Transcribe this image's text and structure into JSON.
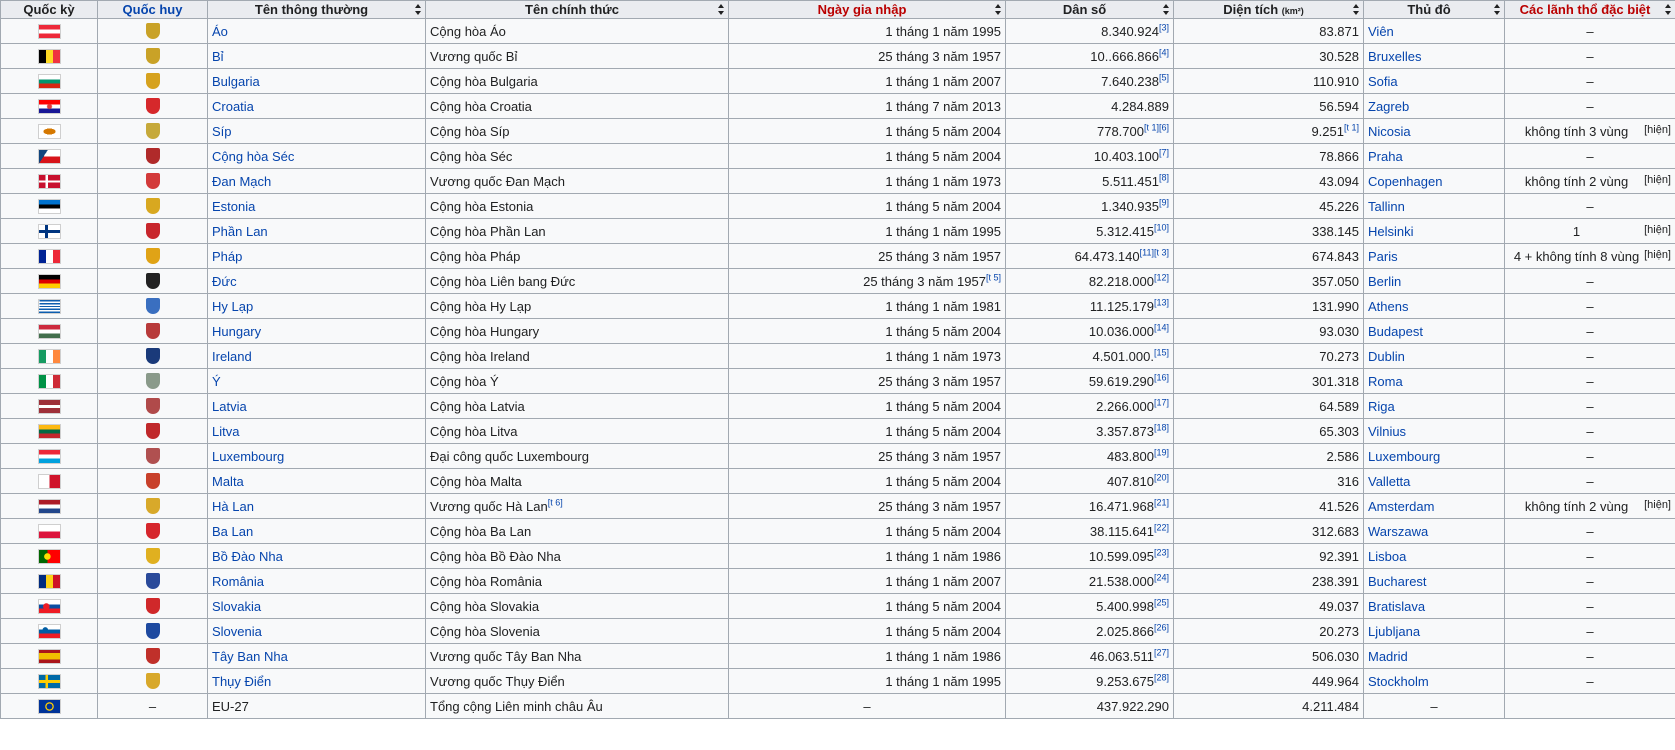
{
  "headers": {
    "flag": "Quốc kỳ",
    "coat": "Quốc huy",
    "common": "Tên thông thường",
    "official": "Tên chính thức",
    "joined": "Ngày gia nhập",
    "population": "Dân số",
    "area": "Diện tích",
    "area_unit": "(km²)",
    "capital": "Thủ đô",
    "special": "Các lãnh thổ đặc biệt"
  },
  "rows": [
    {
      "key": "austria",
      "flag": "austria",
      "coat": "#c9a227",
      "common": "Áo",
      "official": "Cộng hòa Áo",
      "official_sup": "",
      "joined": "1 tháng 1 năm 1995",
      "joined_sup": "",
      "pop": "8.340.924",
      "pop_sup": "[3]",
      "area": "83.871",
      "area_sup": "",
      "capital": "Viên",
      "special": "–",
      "special_sup": ""
    },
    {
      "key": "belgium",
      "flag": "belgium",
      "coat": "#c9a227",
      "common": "Bỉ",
      "official": "Vương quốc Bỉ",
      "official_sup": "",
      "joined": "25 tháng 3 năm 1957",
      "joined_sup": "",
      "pop": "10..666.866",
      "pop_sup": "[4]",
      "area": "30.528",
      "area_sup": "",
      "capital": "Bruxelles",
      "special": "–",
      "special_sup": ""
    },
    {
      "key": "bulgaria",
      "flag": "bulgaria",
      "coat": "#d6a21e",
      "common": "Bulgaria",
      "official": "Cộng hòa Bulgaria",
      "official_sup": "",
      "joined": "1 tháng 1 năm 2007",
      "joined_sup": "",
      "pop": "7.640.238",
      "pop_sup": "[5]",
      "area": "110.910",
      "area_sup": "",
      "capital": "Sofia",
      "special": "–",
      "special_sup": ""
    },
    {
      "key": "croatia",
      "flag": "croatia",
      "coat": "#d6282b",
      "common": "Croatia",
      "official": "Cộng hòa Croatia",
      "official_sup": "",
      "joined": "1 tháng 7 năm 2013",
      "joined_sup": "",
      "pop": "4.284.889",
      "pop_sup": "",
      "area": "56.594",
      "area_sup": "",
      "capital": "Zagreb",
      "special": "–",
      "special_sup": ""
    },
    {
      "key": "cyprus",
      "flag": "cyprus",
      "coat": "#c6a93a",
      "common": "Síp",
      "official": "Cộng hòa Síp",
      "official_sup": "",
      "joined": "1 tháng 5 năm 2004",
      "joined_sup": "",
      "pop": "778.700",
      "pop_sup": "[t 1][6]",
      "area": "9.251",
      "area_sup": "[t 1]",
      "capital": "Nicosia",
      "special": "không tính 3 vùng",
      "special_sup": "[hiện]"
    },
    {
      "key": "czech",
      "flag": "czech",
      "coat": "#b02a2a",
      "common": "Cộng hòa Séc",
      "official": "Cộng hòa Séc",
      "official_sup": "",
      "joined": "1 tháng 5 năm 2004",
      "joined_sup": "",
      "pop": "10.403.100",
      "pop_sup": "[7]",
      "area": "78.866",
      "area_sup": "",
      "capital": "Praha",
      "special": "–",
      "special_sup": ""
    },
    {
      "key": "denmark",
      "flag": "denmark",
      "coat": "#d33a3a",
      "common": "Đan Mạch",
      "official": "Vương quốc Đan Mạch",
      "official_sup": "",
      "joined": "1 tháng 1 năm 1973",
      "joined_sup": "",
      "pop": "5.511.451",
      "pop_sup": "[8]",
      "area": "43.094",
      "area_sup": "",
      "capital": "Copenhagen",
      "special": "không tính 2 vùng",
      "special_sup": "[hiện]"
    },
    {
      "key": "estonia",
      "flag": "estonia",
      "coat": "#d8a820",
      "common": "Estonia",
      "official": "Cộng hòa Estonia",
      "official_sup": "",
      "joined": "1 tháng 5 năm 2004",
      "joined_sup": "",
      "pop": "1.340.935",
      "pop_sup": "[9]",
      "area": "45.226",
      "area_sup": "",
      "capital": "Tallinn",
      "special": "–",
      "special_sup": ""
    },
    {
      "key": "finland",
      "flag": "finland",
      "coat": "#c8262c",
      "common": "Phần Lan",
      "official": "Cộng hòa Phần Lan",
      "official_sup": "",
      "joined": "1 tháng 1 năm 1995",
      "joined_sup": "",
      "pop": "5.312.415",
      "pop_sup": "[10]",
      "area": "338.145",
      "area_sup": "",
      "capital": "Helsinki",
      "special": "1",
      "special_sup": "[hiện]"
    },
    {
      "key": "france",
      "flag": "france",
      "coat": "#e0a316",
      "common": "Pháp",
      "official": "Cộng hòa Pháp",
      "official_sup": "",
      "joined": "25 tháng 3 năm 1957",
      "joined_sup": "",
      "pop": "64.473.140",
      "pop_sup": "[11][t 3]",
      "area": "674.843",
      "area_sup": "",
      "capital": "Paris",
      "special": "4 + không tính 8 vùng",
      "special_sup": "[hiện]"
    },
    {
      "key": "germany",
      "flag": "germany",
      "coat": "#222222",
      "common": "Đức",
      "official": "Cộng hòa Liên bang Đức",
      "official_sup": "",
      "joined": "25 tháng 3 năm 1957",
      "joined_sup": "[t 5]",
      "pop": "82.218.000",
      "pop_sup": "[12]",
      "area": "357.050",
      "area_sup": "",
      "capital": "Berlin",
      "special": "–",
      "special_sup": ""
    },
    {
      "key": "greece",
      "flag": "greece",
      "coat": "#3a6fc0",
      "common": "Hy Lạp",
      "official": "Cộng hòa Hy Lạp",
      "official_sup": "",
      "joined": "1 tháng 1 năm 1981",
      "joined_sup": "",
      "pop": "11.125.179",
      "pop_sup": "[13]",
      "area": "131.990",
      "area_sup": "",
      "capital": "Athens",
      "special": "–",
      "special_sup": ""
    },
    {
      "key": "hungary",
      "flag": "hungary",
      "coat": "#b83a3a",
      "common": "Hungary",
      "official": "Cộng hòa Hungary",
      "official_sup": "",
      "joined": "1 tháng 5 năm 2004",
      "joined_sup": "",
      "pop": "10.036.000",
      "pop_sup": "[14]",
      "area": "93.030",
      "area_sup": "",
      "capital": "Budapest",
      "special": "–",
      "special_sup": ""
    },
    {
      "key": "ireland",
      "flag": "ireland",
      "coat": "#1a3a7a",
      "common": "Ireland",
      "official": "Cộng hòa Ireland",
      "official_sup": "",
      "joined": "1 tháng 1 năm 1973",
      "joined_sup": "",
      "pop": "4.501.000.",
      "pop_sup": "[15]",
      "area": "70.273",
      "area_sup": "",
      "capital": "Dublin",
      "special": "–",
      "special_sup": ""
    },
    {
      "key": "italy",
      "flag": "italy",
      "coat": "#8a9a8a",
      "common": "Ý",
      "official": "Cộng hòa Ý",
      "official_sup": "",
      "joined": "25 tháng 3 năm 1957",
      "joined_sup": "",
      "pop": "59.619.290",
      "pop_sup": "[16]",
      "area": "301.318",
      "area_sup": "",
      "capital": "Roma",
      "special": "–",
      "special_sup": ""
    },
    {
      "key": "latvia",
      "flag": "latvia",
      "coat": "#b04a4a",
      "common": "Latvia",
      "official": "Cộng hòa Latvia",
      "official_sup": "",
      "joined": "1 tháng 5 năm 2004",
      "joined_sup": "",
      "pop": "2.266.000",
      "pop_sup": "[17]",
      "area": "64.589",
      "area_sup": "",
      "capital": "Riga",
      "special": "–",
      "special_sup": ""
    },
    {
      "key": "lithuania",
      "flag": "lithuania",
      "coat": "#c0282a",
      "common": "Litva",
      "official": "Cộng hòa Litva",
      "official_sup": "",
      "joined": "1 tháng 5 năm 2004",
      "joined_sup": "",
      "pop": "3.357.873",
      "pop_sup": "[18]",
      "area": "65.303",
      "area_sup": "",
      "capital": "Vilnius",
      "special": "–",
      "special_sup": ""
    },
    {
      "key": "luxembourg",
      "flag": "luxembourg",
      "coat": "#b05050",
      "common": "Luxembourg",
      "official": "Đại công quốc Luxembourg",
      "official_sup": "",
      "joined": "25 tháng 3 năm 1957",
      "joined_sup": "",
      "pop": "483.800",
      "pop_sup": "[19]",
      "area": "2.586",
      "area_sup": "",
      "capital": "Luxembourg",
      "special": "–",
      "special_sup": ""
    },
    {
      "key": "malta",
      "flag": "malta",
      "coat": "#c8402a",
      "common": "Malta",
      "official": "Cộng hòa Malta",
      "official_sup": "",
      "joined": "1 tháng 5 năm 2004",
      "joined_sup": "",
      "pop": "407.810",
      "pop_sup": "[20]",
      "area": "316",
      "area_sup": "",
      "capital": "Valletta",
      "special": "–",
      "special_sup": ""
    },
    {
      "key": "netherlands",
      "flag": "netherlands",
      "coat": "#d8a92a",
      "common": "Hà Lan",
      "official": "Vương quốc Hà Lan",
      "official_sup": "[t 6]",
      "joined": "25 tháng 3 năm 1957",
      "joined_sup": "",
      "pop": "16.471.968",
      "pop_sup": "[21]",
      "area": "41.526",
      "area_sup": "",
      "capital": "Amsterdam",
      "special": "không tính 2 vùng",
      "special_sup": "[hiện]"
    },
    {
      "key": "poland",
      "flag": "poland",
      "coat": "#d6262c",
      "common": "Ba Lan",
      "official": "Cộng hòa Ba Lan",
      "official_sup": "",
      "joined": "1 tháng 5 năm 2004",
      "joined_sup": "",
      "pop": "38.115.641",
      "pop_sup": "[22]",
      "area": "312.683",
      "area_sup": "",
      "capital": "Warszawa",
      "special": "–",
      "special_sup": ""
    },
    {
      "key": "portugal",
      "flag": "portugal",
      "coat": "#e0b020",
      "common": "Bồ Đào Nha",
      "official": "Cộng hòa Bồ Đào Nha",
      "official_sup": "",
      "joined": "1 tháng 1 năm 1986",
      "joined_sup": "",
      "pop": "10.599.095",
      "pop_sup": "[23]",
      "area": "92.391",
      "area_sup": "",
      "capital": "Lisboa",
      "special": "–",
      "special_sup": ""
    },
    {
      "key": "romania",
      "flag": "romania",
      "coat": "#2a4a9a",
      "common": "România",
      "official": "Cộng hòa România",
      "official_sup": "",
      "joined": "1 tháng 1 năm 2007",
      "joined_sup": "",
      "pop": "21.538.000",
      "pop_sup": "[24]",
      "area": "238.391",
      "area_sup": "",
      "capital": "Bucharest",
      "special": "–",
      "special_sup": ""
    },
    {
      "key": "slovakia",
      "flag": "slovakia",
      "coat": "#d0282a",
      "common": "Slovakia",
      "official": "Cộng hòa Slovakia",
      "official_sup": "",
      "joined": "1 tháng 5 năm 2004",
      "joined_sup": "",
      "pop": "5.400.998",
      "pop_sup": "[25]",
      "area": "49.037",
      "area_sup": "",
      "capital": "Bratislava",
      "special": "–",
      "special_sup": ""
    },
    {
      "key": "slovenia",
      "flag": "slovenia",
      "coat": "#1e4aa0",
      "common": "Slovenia",
      "official": "Cộng hòa Slovenia",
      "official_sup": "",
      "joined": "1 tháng 5 năm 2004",
      "joined_sup": "",
      "pop": "2.025.866",
      "pop_sup": "[26]",
      "area": "20.273",
      "area_sup": "",
      "capital": "Ljubljana",
      "special": "–",
      "special_sup": ""
    },
    {
      "key": "spain",
      "flag": "spain",
      "coat": "#c0302a",
      "common": "Tây Ban Nha",
      "official": "Vương quốc Tây Ban Nha",
      "official_sup": "",
      "joined": "1 tháng 1 năm 1986",
      "joined_sup": "",
      "pop": "46.063.511",
      "pop_sup": "[27]",
      "area": "506.030",
      "area_sup": "",
      "capital": "Madrid",
      "special": "–",
      "special_sup": ""
    },
    {
      "key": "sweden",
      "flag": "sweden",
      "coat": "#d8a82a",
      "common": "Thụy Điển",
      "official": "Vương quốc Thụy Điển",
      "official_sup": "",
      "joined": "1 tháng 1 năm 1995",
      "joined_sup": "",
      "pop": "9.253.675",
      "pop_sup": "[28]",
      "area": "449.964",
      "area_sup": "",
      "capital": "Stockholm",
      "special": "–",
      "special_sup": ""
    }
  ],
  "total": {
    "flag": "eu",
    "coat": "–",
    "common": "EU-27",
    "official": "Tổng cộng Liên minh châu Âu",
    "joined": "–",
    "pop": "437.922.290",
    "area": "4.211.484",
    "capital": "–",
    "special": ""
  },
  "flag_styles": {
    "austria": "linear-gradient(#ed2939 0 33.3%, #ffffff 33.3% 66.6%, #ed2939 66.6%)",
    "belgium": "linear-gradient(90deg, #000000 0 33.3%, #fdda24 33.3% 66.6%, #ef3340 66.6%)",
    "bulgaria": "linear-gradient(#ffffff 0 33.3%, #00966e 33.3% 66.6%, #d62612 66.6%)",
    "croatia": "radial-gradient(circle at 50% 50%, #e23a3a 0 2px, transparent 3px), linear-gradient(#ff0000 0 33.3%, #ffffff 33.3% 66.6%, #171796 66.6%)",
    "cyprus": "radial-gradient(ellipse 6px 3px at 50% 50%, #d57800 0 100%, transparent 100%), linear-gradient(#ffffff, #ffffff)",
    "czech": "linear-gradient(123deg, #11457e 0 30%, transparent 30%), linear-gradient(#ffffff 0 50%, #d7141a 50%)",
    "denmark": "linear-gradient(90deg, transparent 0 30%, #ffffff 30% 42%, transparent 42%), linear-gradient(transparent 0 42%, #ffffff 42% 58%, transparent 58%), linear-gradient(#c8102e, #c8102e)",
    "estonia": "linear-gradient(#0072ce 0 33.3%, #000000 33.3% 66.6%, #ffffff 66.6%)",
    "finland": "linear-gradient(90deg, transparent 0 28%, #003580 28% 42%, transparent 42%), linear-gradient(transparent 0 40%, #003580 40% 60%, transparent 60%), linear-gradient(#ffffff, #ffffff)",
    "france": "linear-gradient(90deg, #002395 0 33.3%, #ffffff 33.3% 66.6%, #ed2939 66.6%)",
    "germany": "linear-gradient(#000000 0 33.3%, #dd0000 33.3% 66.6%, #ffce00 66.6%)",
    "greece": "linear-gradient(90deg, transparent 0 8%, #ffffff 8% 14%, transparent 14%) 0 0 / 40% 55% no-repeat, linear-gradient(#0d5eaf 0 11.1%, #ffffff 11.1% 22.2%, #0d5eaf 22.2% 33.3%, #ffffff 33.3% 44.4%, #0d5eaf 44.4% 55.5%, #ffffff 55.5% 66.6%, #0d5eaf 66.6% 77.7%, #ffffff 77.7% 88.8%, #0d5eaf 88.8%)",
    "hungary": "linear-gradient(#cd2a3e 0 33.3%, #ffffff 33.3% 66.6%, #436f4d 66.6%)",
    "ireland": "linear-gradient(90deg, #169b62 0 33.3%, #ffffff 33.3% 66.6%, #ff883e 66.6%)",
    "italy": "linear-gradient(90deg, #009246 0 33.3%, #ffffff 33.3% 66.6%, #ce2b37 66.6%)",
    "latvia": "linear-gradient(#9e3039 0 40%, #ffffff 40% 60%, #9e3039 60%)",
    "lithuania": "linear-gradient(#fdb913 0 33.3%, #006a44 33.3% 66.6%, #c1272d 66.6%)",
    "luxembourg": "linear-gradient(#ed2939 0 33.3%, #ffffff 33.3% 66.6%, #00a1de 66.6%)",
    "malta": "linear-gradient(90deg, #ffffff 0 50%, #cf142b 50%)",
    "netherlands": "linear-gradient(#ae1c28 0 33.3%, #ffffff 33.3% 66.6%, #21468b 66.6%)",
    "poland": "linear-gradient(#ffffff 0 50%, #dc143c 50%)",
    "portugal": "radial-gradient(circle at 40% 50%, #ffe000 0 3px, transparent 3.5px), linear-gradient(90deg, #006600 0 40%, #ff0000 40%)",
    "romania": "linear-gradient(90deg, #002b7f 0 33.3%, #fcd116 33.3% 66.6%, #ce1126 66.6%)",
    "slovakia": "radial-gradient(circle at 35% 50%, #ee1c25 0 3px, transparent 3.5px), linear-gradient(#ffffff 0 33.3%, #0b4ea2 33.3% 66.6%, #ee1c25 66.6%)",
    "slovenia": "radial-gradient(circle at 30% 38%, #005da4 0 2.5px, transparent 3px), linear-gradient(#ffffff 0 33.3%, #005da4 33.3% 66.6%, #ed1c24 66.6%)",
    "spain": "linear-gradient(#aa151b 0 25%, #f1bf00 25% 75%, #aa151b 75%)",
    "sweden": "linear-gradient(90deg, transparent 0 30%, #fecc02 30% 44%, transparent 44%), linear-gradient(transparent 0 40%, #fecc02 40% 60%, transparent 60%), linear-gradient(#006aa7, #006aa7)",
    "eu": "radial-gradient(circle at 50% 50%, transparent 0 3px, #ffcc00 3px 4px, transparent 4.5px), linear-gradient(#003399, #003399)"
  }
}
